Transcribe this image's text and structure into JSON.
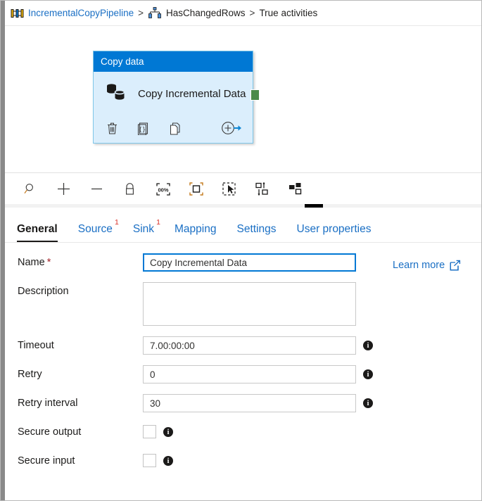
{
  "breadcrumb": {
    "pipeline_icon": "pipeline-icon",
    "pipeline": "IncrementalCopyPipeline",
    "sep1": ">",
    "activity_icon": "if-condition-icon",
    "activity": "HasChangedRows",
    "sep2": ">",
    "branch": "True activities"
  },
  "canvas": {
    "node": {
      "header": "Copy data",
      "type_icon": "copy-data-icon",
      "title": "Copy Incremental Data",
      "actions": [
        {
          "name": "delete-icon",
          "label": "Delete"
        },
        {
          "name": "code-icon",
          "label": "Code"
        },
        {
          "name": "clone-icon",
          "label": "Clone"
        },
        {
          "name": "add-output-icon",
          "label": "Add output"
        }
      ],
      "output_port": "success-output-port"
    },
    "toolbar": [
      {
        "name": "search-icon",
        "label": "Search"
      },
      {
        "name": "zoom-in-icon",
        "label": "Zoom in"
      },
      {
        "name": "zoom-out-icon",
        "label": "Zoom out"
      },
      {
        "name": "lock-icon",
        "label": "Lock canvas"
      },
      {
        "name": "zoom-100-icon",
        "label": "100%"
      },
      {
        "name": "fit-to-screen-icon",
        "label": "Fit to screen"
      },
      {
        "name": "select-tool-icon",
        "label": "Select"
      },
      {
        "name": "auto-align-icon",
        "label": "Auto align"
      },
      {
        "name": "auto-layout-icon",
        "label": "Auto layout"
      }
    ]
  },
  "tabs": [
    {
      "label": "General",
      "badge": "",
      "active": true
    },
    {
      "label": "Source",
      "badge": "1",
      "active": false
    },
    {
      "label": "Sink",
      "badge": "1",
      "active": false
    },
    {
      "label": "Mapping",
      "badge": "",
      "active": false
    },
    {
      "label": "Settings",
      "badge": "",
      "active": false
    },
    {
      "label": "User properties",
      "badge": "",
      "active": false
    }
  ],
  "form": {
    "name": {
      "label": "Name",
      "required": "*",
      "value": "Copy Incremental Data"
    },
    "description": {
      "label": "Description",
      "value": ""
    },
    "timeout": {
      "label": "Timeout",
      "value": "7.00:00:00"
    },
    "retry": {
      "label": "Retry",
      "value": "0"
    },
    "retry_interval": {
      "label": "Retry interval",
      "value": "30"
    },
    "secure_output": {
      "label": "Secure output",
      "checked": false
    },
    "secure_input": {
      "label": "Secure input",
      "checked": false
    },
    "learn_more": {
      "label": "Learn more",
      "icon": "external-link-icon"
    }
  },
  "colors": {
    "accent_blue": "#0078d4",
    "link_blue": "#1a6fc4",
    "node_body": "#dbeefc",
    "node_border": "#7ec6e8",
    "port_green": "#4b8b4b",
    "badge_red": "#d93025",
    "required_red": "#a4262c"
  }
}
